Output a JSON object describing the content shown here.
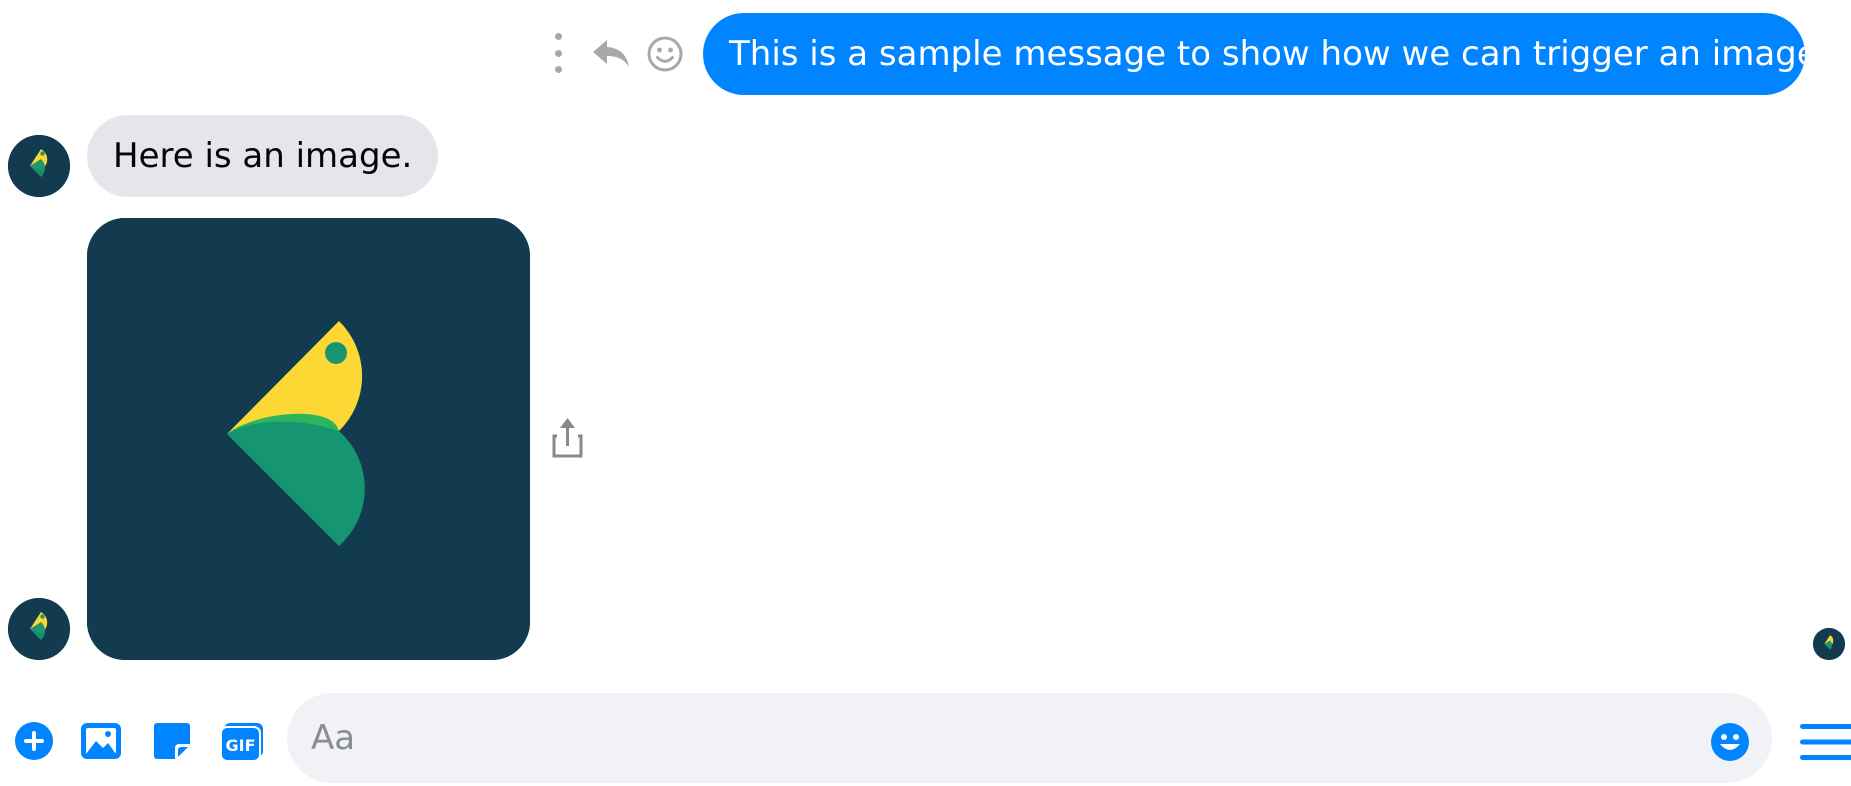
{
  "colors": {
    "accent": "#0084ff",
    "incoming_bubble": "#e4e6eb",
    "composer_bg": "#f0f2f5",
    "brand_dark": "#123b4f",
    "logo_yellow": "#fdd835",
    "logo_green": "#2db55d",
    "logo_teal": "#159570"
  },
  "conversation": {
    "outgoing": {
      "text": "This is a sample message to show how we can trigger an image.",
      "actions": [
        "more-icon",
        "reply-icon",
        "react-icon"
      ]
    },
    "incoming": {
      "text": "Here is an image.",
      "avatar_icon": "bot-logo-icon",
      "image_icon": "bot-logo-icon",
      "share_icon": "share-icon"
    },
    "seen_indicator_icon": "bot-logo-icon"
  },
  "composer": {
    "placeholder": "Aa",
    "value": "",
    "gif_label": "GIF",
    "icons": [
      "plus-icon",
      "photo-icon",
      "sticker-icon",
      "gif-icon",
      "emoji-icon",
      "menu-icon"
    ]
  }
}
